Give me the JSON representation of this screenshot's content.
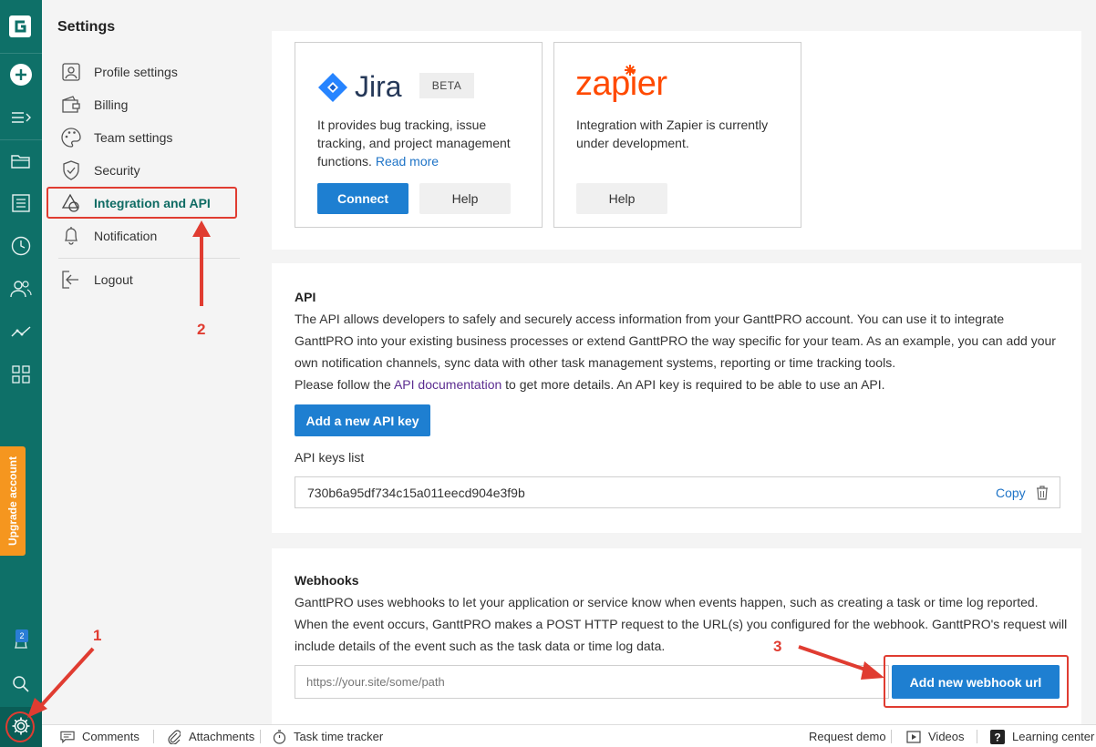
{
  "rail": {
    "upgrade_label": "Upgrade account",
    "notification_count": "2"
  },
  "settings": {
    "title": "Settings",
    "items": [
      {
        "label": "Profile settings",
        "icon": "profile-icon"
      },
      {
        "label": "Billing",
        "icon": "wallet-icon"
      },
      {
        "label": "Team settings",
        "icon": "palette-icon"
      },
      {
        "label": "Security",
        "icon": "shield-icon"
      },
      {
        "label": "Integration and API",
        "icon": "shapes-icon",
        "active": true
      },
      {
        "label": "Notification",
        "icon": "bell-icon"
      },
      {
        "label": "Logout",
        "icon": "logout-icon"
      }
    ]
  },
  "integrations": {
    "jira": {
      "name": "Jira",
      "badge": "BETA",
      "description": "It provides bug tracking, issue tracking, and project management functions.",
      "read_more": "Read more",
      "connect_label": "Connect",
      "help_label": "Help"
    },
    "zapier": {
      "name": "zapier",
      "description": "Integration with Zapier is currently under development.",
      "help_label": "Help"
    }
  },
  "api": {
    "title": "API",
    "description": "The API allows developers to safely and securely access information from your GanttPRO account. You can use it to integrate GanttPRO into your existing business processes or extend GanttPRO the way specific for your team. As an example, you can add your own notification channels, sync data with other task management systems, reporting or time tracking tools.",
    "follow_prefix": "Please follow the ",
    "doc_link": "API documentation",
    "follow_suffix": " to get more details. An API key is required to be able to use an API.",
    "add_key_label": "Add a new API key",
    "keys_list_label": "API keys list",
    "key_value": "730b6a95df734c15a011eecd904e3f9b",
    "copy_label": "Copy"
  },
  "webhooks": {
    "title": "Webhooks",
    "description": "GanttPRO uses webhooks to let your application or service know when events happen, such as creating a task or time log reported. When the event occurs, GanttPRO makes a POST HTTP request to the URL(s) you configured for the webhook. GanttPRO's request will include details of the event such as the task data or time log data.",
    "url_placeholder": "https://your.site/some/path",
    "add_label": "Add new webhook url"
  },
  "annotations": {
    "step1": "1",
    "step2": "2",
    "step3": "3",
    "color": "#e03c31"
  },
  "footer": {
    "comments": "Comments",
    "attachments": "Attachments",
    "time_tracker": "Task time tracker",
    "request_demo": "Request demo",
    "videos": "Videos",
    "learning_center": "Learning center"
  },
  "colors": {
    "rail": "#0e7068",
    "primary": "#1e7fd1",
    "upgrade": "#f5961f",
    "active_nav": "#0e6b63"
  }
}
